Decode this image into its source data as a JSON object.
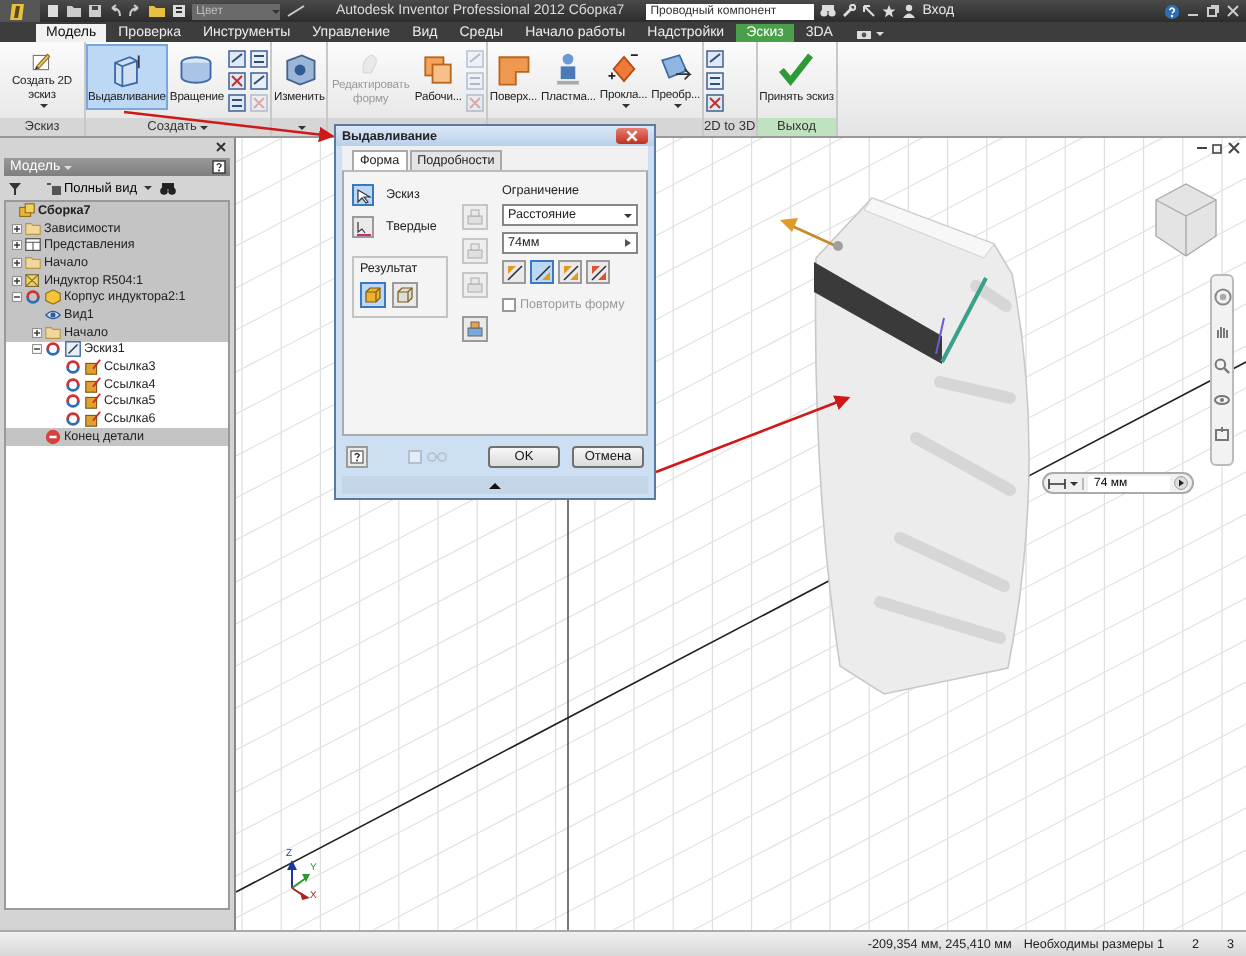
{
  "title_bar": {
    "color_dropdown": "Цвет",
    "title": "Autodesk Inventor Professional 2012   Сборка7",
    "search": {
      "value": "Проводный компонент"
    },
    "sign_in": "Вход"
  },
  "tabs": [
    {
      "label": "Модель",
      "selected": true,
      "kind": "normal"
    },
    {
      "label": "Проверка",
      "selected": false,
      "kind": "normal"
    },
    {
      "label": "Инструменты",
      "selected": false,
      "kind": "normal"
    },
    {
      "label": "Управление",
      "selected": false,
      "kind": "normal"
    },
    {
      "label": "Вид",
      "selected": false,
      "kind": "normal"
    },
    {
      "label": "Среды",
      "selected": false,
      "kind": "normal"
    },
    {
      "label": "Начало работы",
      "selected": false,
      "kind": "normal"
    },
    {
      "label": "Надстройки",
      "selected": false,
      "kind": "normal"
    },
    {
      "label": "Эскиз",
      "selected": false,
      "kind": "contextual"
    },
    {
      "label": "3DA",
      "selected": false,
      "kind": "normal"
    }
  ],
  "ribbon": {
    "panels": [
      {
        "label": "Эскиз",
        "menu": false,
        "kind": "normal",
        "items": [
          {
            "kind": "large",
            "label": "Создать 2D эскиз",
            "menu": true,
            "selected": false,
            "disabled": false
          }
        ]
      },
      {
        "label": "Создать",
        "menu": true,
        "kind": "normal",
        "items": [
          {
            "kind": "large",
            "label": "Выдавливание",
            "menu": false,
            "selected": true,
            "disabled": false
          },
          {
            "kind": "large",
            "label": "Вращение",
            "menu": false,
            "selected": false,
            "disabled": false
          },
          {
            "kind": "small",
            "icons": [
              {
                "disabled": false
              },
              {
                "disabled": false
              },
              {
                "disabled": false
              },
              {
                "disabled": false
              },
              {
                "disabled": false
              },
              {
                "disabled": true
              }
            ]
          }
        ]
      },
      {
        "menu": true,
        "kind": "normal",
        "items": [
          {
            "kind": "large",
            "label": "Изменить",
            "menu": false,
            "selected": false,
            "disabled": false
          }
        ]
      },
      {
        "menu": false,
        "kind": "normal",
        "items": [
          {
            "kind": "large",
            "label": "Редактировать форму",
            "menu": false,
            "selected": false,
            "disabled": true
          },
          {
            "kind": "large",
            "label": "Рабочи...",
            "menu": false,
            "selected": false,
            "disabled": false
          },
          {
            "kind": "small",
            "icons": [
              {
                "disabled": true
              },
              {
                "disabled": true
              },
              {
                "disabled": true
              }
            ]
          }
        ]
      },
      {
        "menu": false,
        "kind": "normal",
        "items": [
          {
            "kind": "large",
            "label": "Поверх...",
            "menu": false,
            "selected": false,
            "disabled": false
          },
          {
            "kind": "large",
            "label": "Пластма...",
            "menu": false,
            "selected": false,
            "disabled": false
          },
          {
            "kind": "large",
            "label": "Прокла...",
            "menu": true,
            "selected": false,
            "disabled": false
          },
          {
            "kind": "large",
            "label": "Преобр...",
            "menu": true,
            "selected": false,
            "disabled": false
          }
        ]
      },
      {
        "label": "2D to 3D",
        "menu": false,
        "kind": "normal",
        "items": [
          {
            "kind": "small",
            "icons": [
              {
                "disabled": false
              },
              {
                "disabled": false
              },
              {
                "disabled": false
              }
            ]
          }
        ]
      },
      {
        "label": "Выход",
        "menu": false,
        "kind": "exit",
        "items": [
          {
            "kind": "large",
            "label": "Принять эскиз",
            "menu": false,
            "selected": false,
            "disabled": false
          }
        ]
      }
    ]
  },
  "browser": {
    "title": "Модель",
    "view_mode": "Полный вид",
    "tree": [
      {
        "label": "Сборка7",
        "kind": "assembly",
        "active": false,
        "adaptive": false,
        "children": [
          {
            "label": "Зависимости",
            "kind": "folder",
            "active": false,
            "adaptive": false,
            "expanded": false
          },
          {
            "label": "Представления",
            "kind": "views",
            "active": false,
            "adaptive": false,
            "expanded": false
          },
          {
            "label": "Начало",
            "kind": "folder",
            "active": false,
            "adaptive": false,
            "expanded": false
          },
          {
            "label": "Индуктор R504:1",
            "kind": "component",
            "active": false,
            "adaptive": false,
            "expanded": false
          },
          {
            "label": "Корпус индуктора2:1",
            "kind": "part",
            "active": false,
            "adaptive": true,
            "expanded": true,
            "children": [
              {
                "label": "Вид1",
                "kind": "view",
                "active": false,
                "adaptive": false
              },
              {
                "label": "Начало",
                "kind": "folder",
                "active": false,
                "adaptive": false,
                "expanded": false
              },
              {
                "label": "Эскиз1",
                "kind": "sketch",
                "active": true,
                "adaptive": true,
                "expanded": true,
                "children": [
                  {
                    "label": "Ссылка3",
                    "kind": "reference",
                    "active": true,
                    "adaptive": true
                  },
                  {
                    "label": "Ссылка4",
                    "kind": "reference",
                    "active": true,
                    "adaptive": true
                  },
                  {
                    "label": "Ссылка5",
                    "kind": "reference",
                    "active": true,
                    "adaptive": true
                  },
                  {
                    "label": "Ссылка6",
                    "kind": "reference",
                    "active": true,
                    "adaptive": true
                  }
                ]
              },
              {
                "label": "Конец детали",
                "kind": "end",
                "active": false,
                "adaptive": false
              }
            ]
          }
        ]
      }
    ]
  },
  "dialog": {
    "title": "Выдавливание",
    "tabs": [
      {
        "label": "Форма",
        "selected": true
      },
      {
        "label": "Подробности",
        "selected": false
      }
    ],
    "profile": {
      "label": "Эскиз",
      "selected": true
    },
    "solids": {
      "label": "Твердые",
      "selected": false
    },
    "result": {
      "title": "Результат",
      "options": [
        {
          "selected": true
        },
        {
          "selected": false
        }
      ]
    },
    "operations": [
      {
        "disabled": true
      },
      {
        "disabled": true
      },
      {
        "disabled": true
      },
      {
        "disabled": false
      }
    ],
    "extents": {
      "title": "Ограничение",
      "type": "Расстояние",
      "distance": "74мм",
      "directions": [
        {
          "selected": false
        },
        {
          "selected": true
        },
        {
          "selected": false
        },
        {
          "selected": false
        }
      ]
    },
    "match_shape": {
      "label": "Повторить форму",
      "checked": false,
      "disabled": true
    },
    "preview": {
      "checked": false,
      "disabled": true
    },
    "buttons": [
      "OK",
      "Отмена"
    ]
  },
  "canvas": {
    "dimension_input": {
      "value": "74 мм"
    },
    "axes": [
      "Z",
      "Y",
      "X"
    ]
  },
  "status_bar": {
    "coordinates": "-209,354 мм, 245,410 мм",
    "message": "Необходимы размеры 1",
    "counts": [
      "2",
      "3"
    ]
  }
}
